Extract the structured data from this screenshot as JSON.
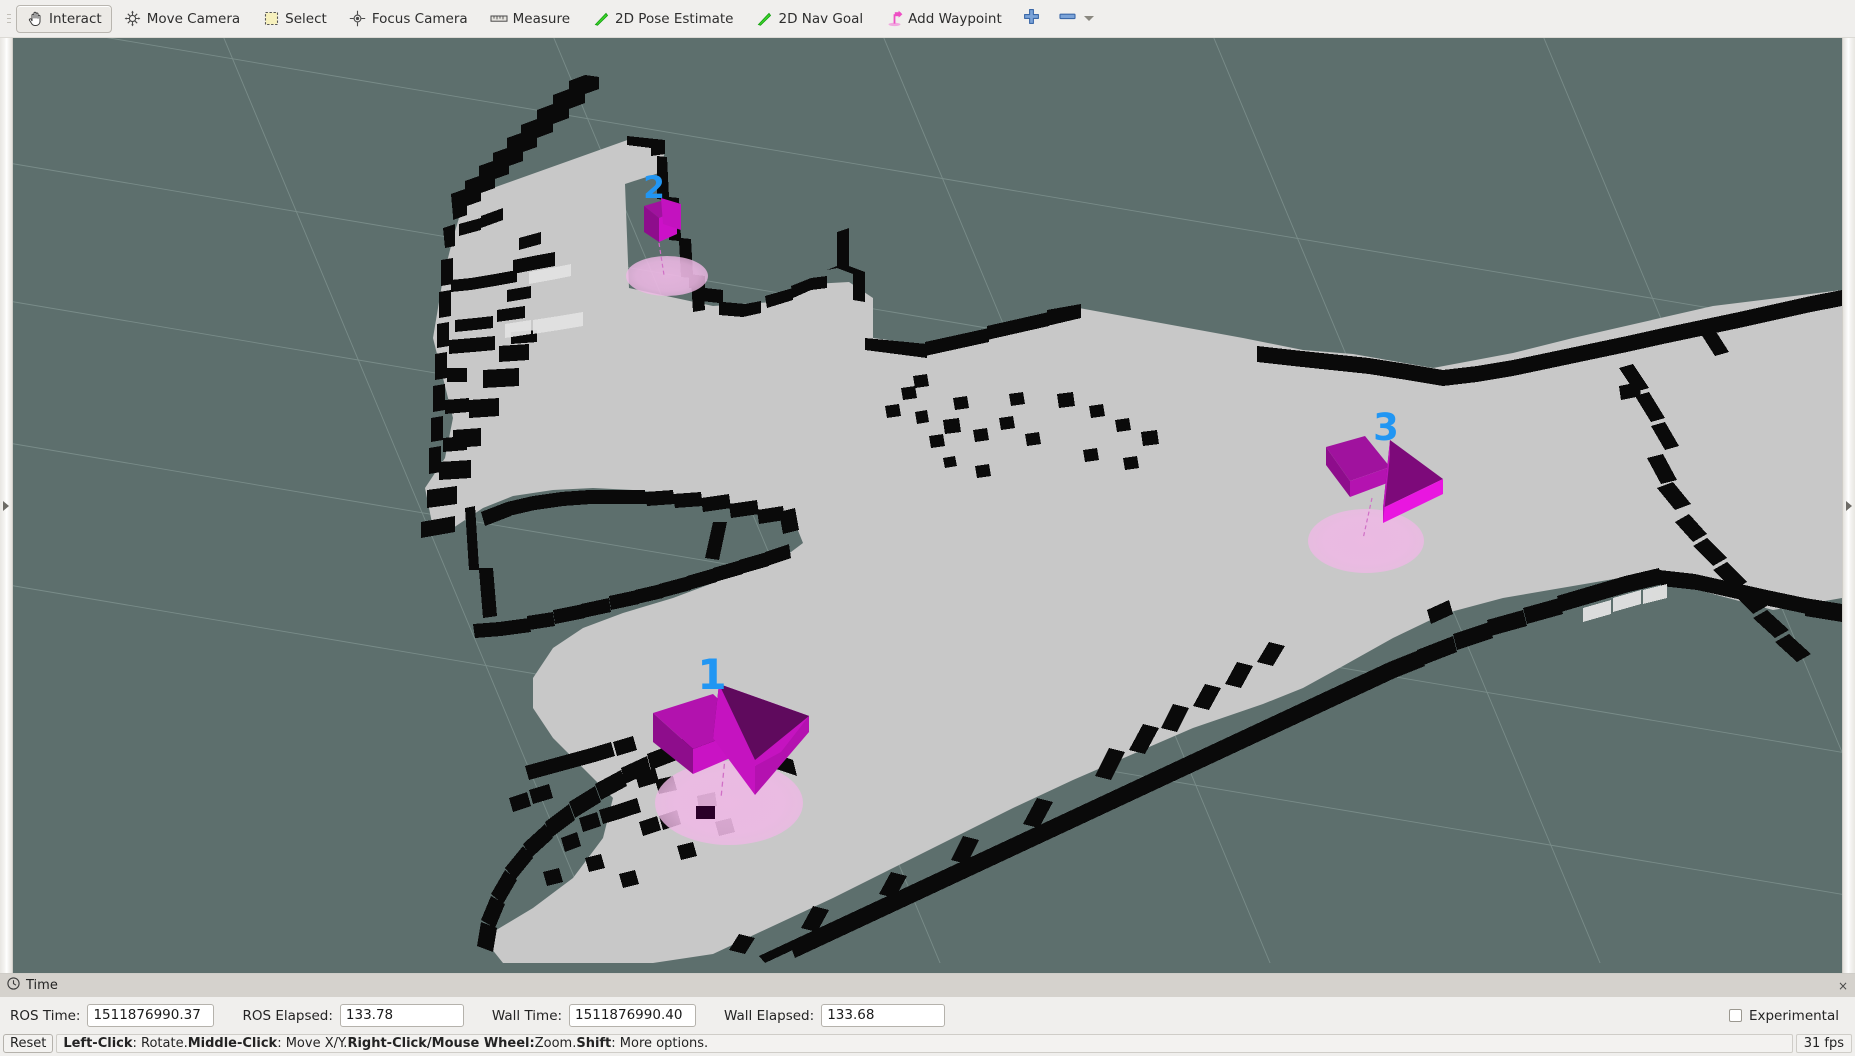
{
  "toolbar": {
    "buttons": [
      {
        "label": "Interact",
        "icon": "hand-cursor-icon",
        "active": true
      },
      {
        "label": "Move Camera",
        "icon": "move-camera-icon",
        "active": false
      },
      {
        "label": "Select",
        "icon": "select-rect-icon",
        "active": false
      },
      {
        "label": "Focus Camera",
        "icon": "focus-camera-icon",
        "active": false
      },
      {
        "label": "Measure",
        "icon": "ruler-icon",
        "active": false
      },
      {
        "label": "2D Pose Estimate",
        "icon": "green-arrow-icon",
        "active": false
      },
      {
        "label": "2D Nav Goal",
        "icon": "green-arrow-icon",
        "active": false
      },
      {
        "label": "Add Waypoint",
        "icon": "pink-waypoint-icon",
        "active": false
      }
    ],
    "extra_icons": [
      "plus-icon",
      "minus-bar-icon",
      "chevron-down-icon"
    ]
  },
  "view3d": {
    "background_color": "#5d6f6d",
    "map_free_color": "#c8c8c8",
    "map_occupied_color": "#080808",
    "grid_line_color": "#8ca09c",
    "waypoints": [
      {
        "id": "1",
        "label": "1",
        "label_color": "#2196f3",
        "arrow_color": "#cc00cc",
        "disc_color": "#edb8e3"
      },
      {
        "id": "2",
        "label": "2",
        "label_color": "#2196f3",
        "arrow_color": "#cc00cc",
        "disc_color": "#edb8e3"
      },
      {
        "id": "3",
        "label": "3",
        "label_color": "#2196f3",
        "arrow_color": "#cc00cc",
        "disc_color": "#edb8e3"
      }
    ]
  },
  "time_panel": {
    "title": "Time",
    "icon": "clock-icon",
    "close_label": "×",
    "fields": [
      {
        "label": "ROS Time:",
        "value": "1511876990.37"
      },
      {
        "label": "ROS Elapsed:",
        "value": "133.78"
      },
      {
        "label": "Wall Time:",
        "value": "1511876990.40"
      },
      {
        "label": "Wall Elapsed:",
        "value": "133.68"
      }
    ],
    "experimental_label": "Experimental",
    "experimental_checked": false
  },
  "status_bar": {
    "reset_label": "Reset",
    "help_segments": [
      {
        "text": "Left-Click",
        "bold": true
      },
      {
        "text": ": Rotate. ",
        "bold": false
      },
      {
        "text": "Middle-Click",
        "bold": true
      },
      {
        "text": ": Move X/Y. ",
        "bold": false
      },
      {
        "text": "Right-Click/Mouse Wheel:",
        "bold": true
      },
      {
        "text": " Zoom. ",
        "bold": false
      },
      {
        "text": "Shift",
        "bold": true
      },
      {
        "text": ": More options.",
        "bold": false
      }
    ],
    "fps": "31 fps"
  }
}
